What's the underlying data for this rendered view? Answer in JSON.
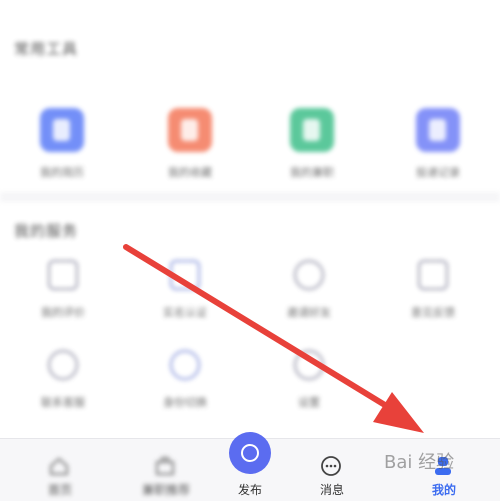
{
  "common_tools": {
    "title": "常用工具",
    "items": [
      {
        "label": "我的简历",
        "icon": "resume-icon",
        "color": "#5b7cf7"
      },
      {
        "label": "我的收藏",
        "icon": "collection-icon",
        "color": "#f4785a"
      },
      {
        "label": "我的兼职",
        "icon": "parttime-icon",
        "color": "#3fbf8a"
      },
      {
        "label": "投递记录",
        "icon": "record-icon",
        "color": "#6f7ff7"
      }
    ]
  },
  "my_services": {
    "title": "我的服务",
    "items": [
      {
        "label": "我的评价",
        "icon": "calendar-icon"
      },
      {
        "label": "实名认证",
        "icon": "verify-icon"
      },
      {
        "label": "邀请好友",
        "icon": "person-icon"
      },
      {
        "label": "意见反馈",
        "icon": "feedback-icon"
      },
      {
        "label": "联系客服",
        "icon": "headset-icon"
      },
      {
        "label": "身份切换",
        "icon": "switch-icon"
      },
      {
        "label": "设置",
        "icon": "settings-icon"
      }
    ]
  },
  "tabbar": {
    "home": "首页",
    "parttime": "兼职推荐",
    "publish": "发布",
    "messages": "消息",
    "mine": "我的"
  },
  "colors": {
    "accent": "#5b6cf0",
    "active_tab": "#3c6cf0",
    "arrow": "#e8413a"
  },
  "watermark": "Bai 经验"
}
